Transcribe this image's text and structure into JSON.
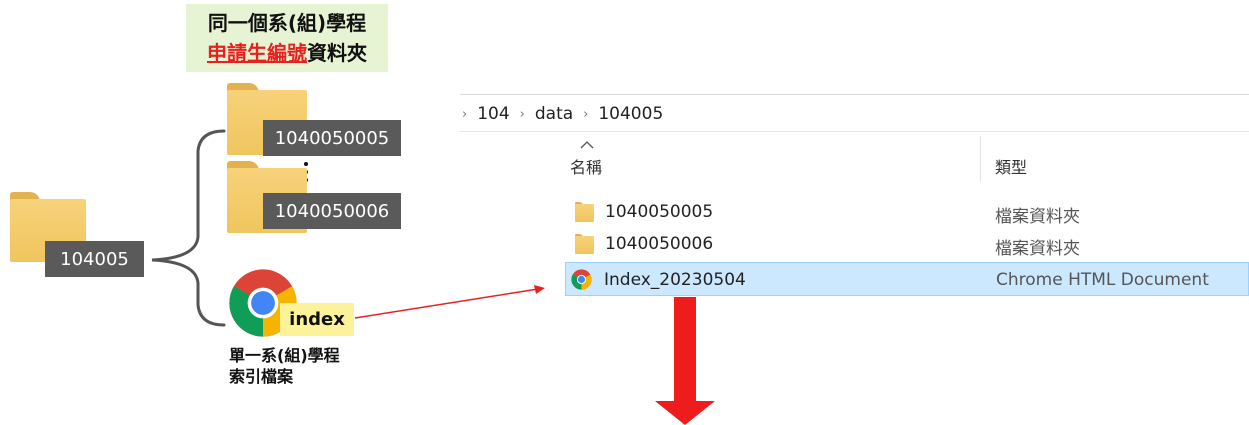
{
  "heading": {
    "line1": "同一個系(組)學程",
    "line2_red": "申請生編號",
    "line2_rest": "資料夾"
  },
  "left_folder": {
    "label": "104005"
  },
  "subfolders": [
    {
      "label": "1040050005"
    },
    {
      "label": "1040050006"
    }
  ],
  "index_file": {
    "label": "index",
    "caption_line1": "單一系(組)學程",
    "caption_line2": "索引檔案"
  },
  "explorer": {
    "breadcrumb": [
      "104",
      "data",
      "104005"
    ],
    "breadcrumb_separator": "›",
    "columns": {
      "name": "名稱",
      "type": "類型"
    },
    "rows": [
      {
        "name": "1040050005",
        "type": "檔案資料夾",
        "icon": "folder-icon"
      },
      {
        "name": "1040050006",
        "type": "檔案資料夾",
        "icon": "folder-icon"
      },
      {
        "name": "Index_20230504",
        "type": "Chrome HTML Document",
        "icon": "chrome-icon",
        "selected": true
      }
    ]
  },
  "colors": {
    "red_arrow": "#ee1c1c",
    "connector_red": "#e8211f",
    "heading_bg": "#e6f4d4",
    "label_dark": "#5a5a5a",
    "index_label_bg": "#fbf29a",
    "selection": "#cce8ff"
  }
}
